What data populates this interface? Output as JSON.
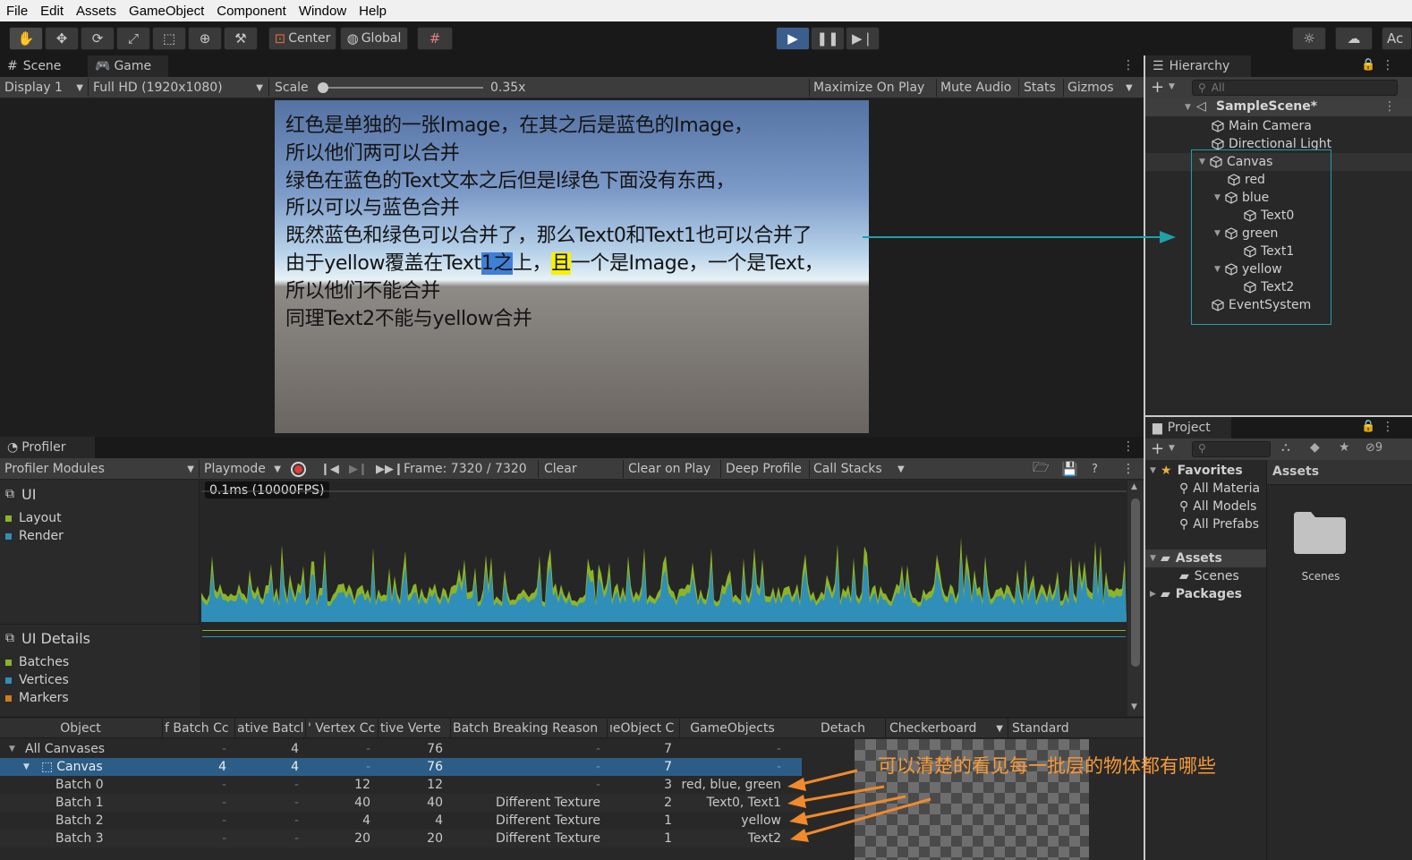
{
  "menu": [
    "File",
    "Edit",
    "Assets",
    "GameObject",
    "Component",
    "Window",
    "Help"
  ],
  "toolbar": {
    "center": "Center",
    "global": "Global",
    "account": "Ac"
  },
  "scene_tabs": {
    "scene": "Scene",
    "game": "Game"
  },
  "game_bar": {
    "display": "Display 1",
    "resolution": "Full HD (1920x1080)",
    "scale_label": "Scale",
    "scale_value": "0.35x",
    "maximize": "Maximize On Play",
    "mute": "Mute Audio",
    "stats": "Stats",
    "gizmos": "Gizmos"
  },
  "game_text": {
    "line1": "红色是单独的一张Image，在其之后是蓝色的Image，",
    "line2": "所以他们两可以合并",
    "line3": "绿色在蓝色的Text文本之后但是l绿色下面没有东西，",
    "line4": "所以可以与蓝色合并",
    "line5": "既然蓝色和绿色可以合并了，那么Text0和Text1也可以合并了",
    "line6_a": "由于yellow覆盖在Text",
    "line6_b": "1之",
    "line6_c": "上，",
    "line6_d": "且",
    "line6_e": "一个是Image，一个是Text，",
    "line7": "所以他们不能合并",
    "line8": "同理Text2不能与yellow合并"
  },
  "hierarchy": {
    "title": "Hierarchy",
    "search_placeholder": "All",
    "scene": "SampleScene*",
    "items": [
      "Main Camera",
      "Directional Light",
      "Canvas",
      "red",
      "blue",
      "Text0",
      "green",
      "Text1",
      "yellow",
      "Text2",
      "EventSystem"
    ]
  },
  "project": {
    "title": "Project",
    "badge": "9",
    "favorites": "Favorites",
    "fav_items": [
      "All Materia",
      "All Models",
      "All Prefabs"
    ],
    "assets": "Assets",
    "asset_items": [
      "Scenes"
    ],
    "packages": "Packages",
    "assets_header": "Assets",
    "folder_label": "Scenes"
  },
  "profiler": {
    "title": "Profiler",
    "modules": "Profiler Modules",
    "playmode": "Playmode",
    "frame": "Frame: 7320 / 7320",
    "clear": "Clear",
    "clear_on_play": "Clear on Play",
    "deep_profile": "Deep Profile",
    "call_stacks": "Call Stacks",
    "ui_label": "UI",
    "ui_items": [
      {
        "name": "Layout",
        "color": "#8cb428"
      },
      {
        "name": "Render",
        "color": "#2f8fb8"
      }
    ],
    "ui_details_label": "UI Details",
    "detail_items": [
      {
        "name": "Batches",
        "color": "#8cb428"
      },
      {
        "name": "Vertices",
        "color": "#2f8fb8"
      },
      {
        "name": "Markers",
        "color": "#d27a1e"
      }
    ],
    "fps_label": "0.1ms (10000FPS)"
  },
  "table": {
    "headers": [
      "Object",
      "f Batch Cc",
      "ative Batcl",
      "' Vertex Cc",
      "tive Verte",
      "Batch Breaking Reason",
      "ıeObject C",
      "GameObjects"
    ],
    "right_headers": [
      "Detach",
      "Checkerboard",
      "Standard"
    ],
    "rows": [
      [
        "All Canvases",
        "-",
        "4",
        "-",
        "76",
        "-",
        "7",
        "-"
      ],
      [
        "Canvas",
        "4",
        "4",
        "-",
        "76",
        "-",
        "7",
        "-"
      ],
      [
        "Batch 0",
        "-",
        "-",
        "12",
        "12",
        "-",
        "3",
        "red, blue, green"
      ],
      [
        "Batch 1",
        "-",
        "-",
        "40",
        "40",
        "Different Texture",
        "2",
        "Text0, Text1"
      ],
      [
        "Batch 2",
        "-",
        "-",
        "4",
        "4",
        "Different Texture",
        "1",
        "yellow"
      ],
      [
        "Batch 3",
        "-",
        "-",
        "20",
        "20",
        "Different Texture",
        "1",
        "Text2"
      ]
    ]
  },
  "annotation": "可以清楚的看见每一批层的物体都有哪些",
  "colors": {
    "accent_teal": "#1fa0a8",
    "annot_orange": "#f08a2c",
    "selection": "#2c5d87"
  }
}
